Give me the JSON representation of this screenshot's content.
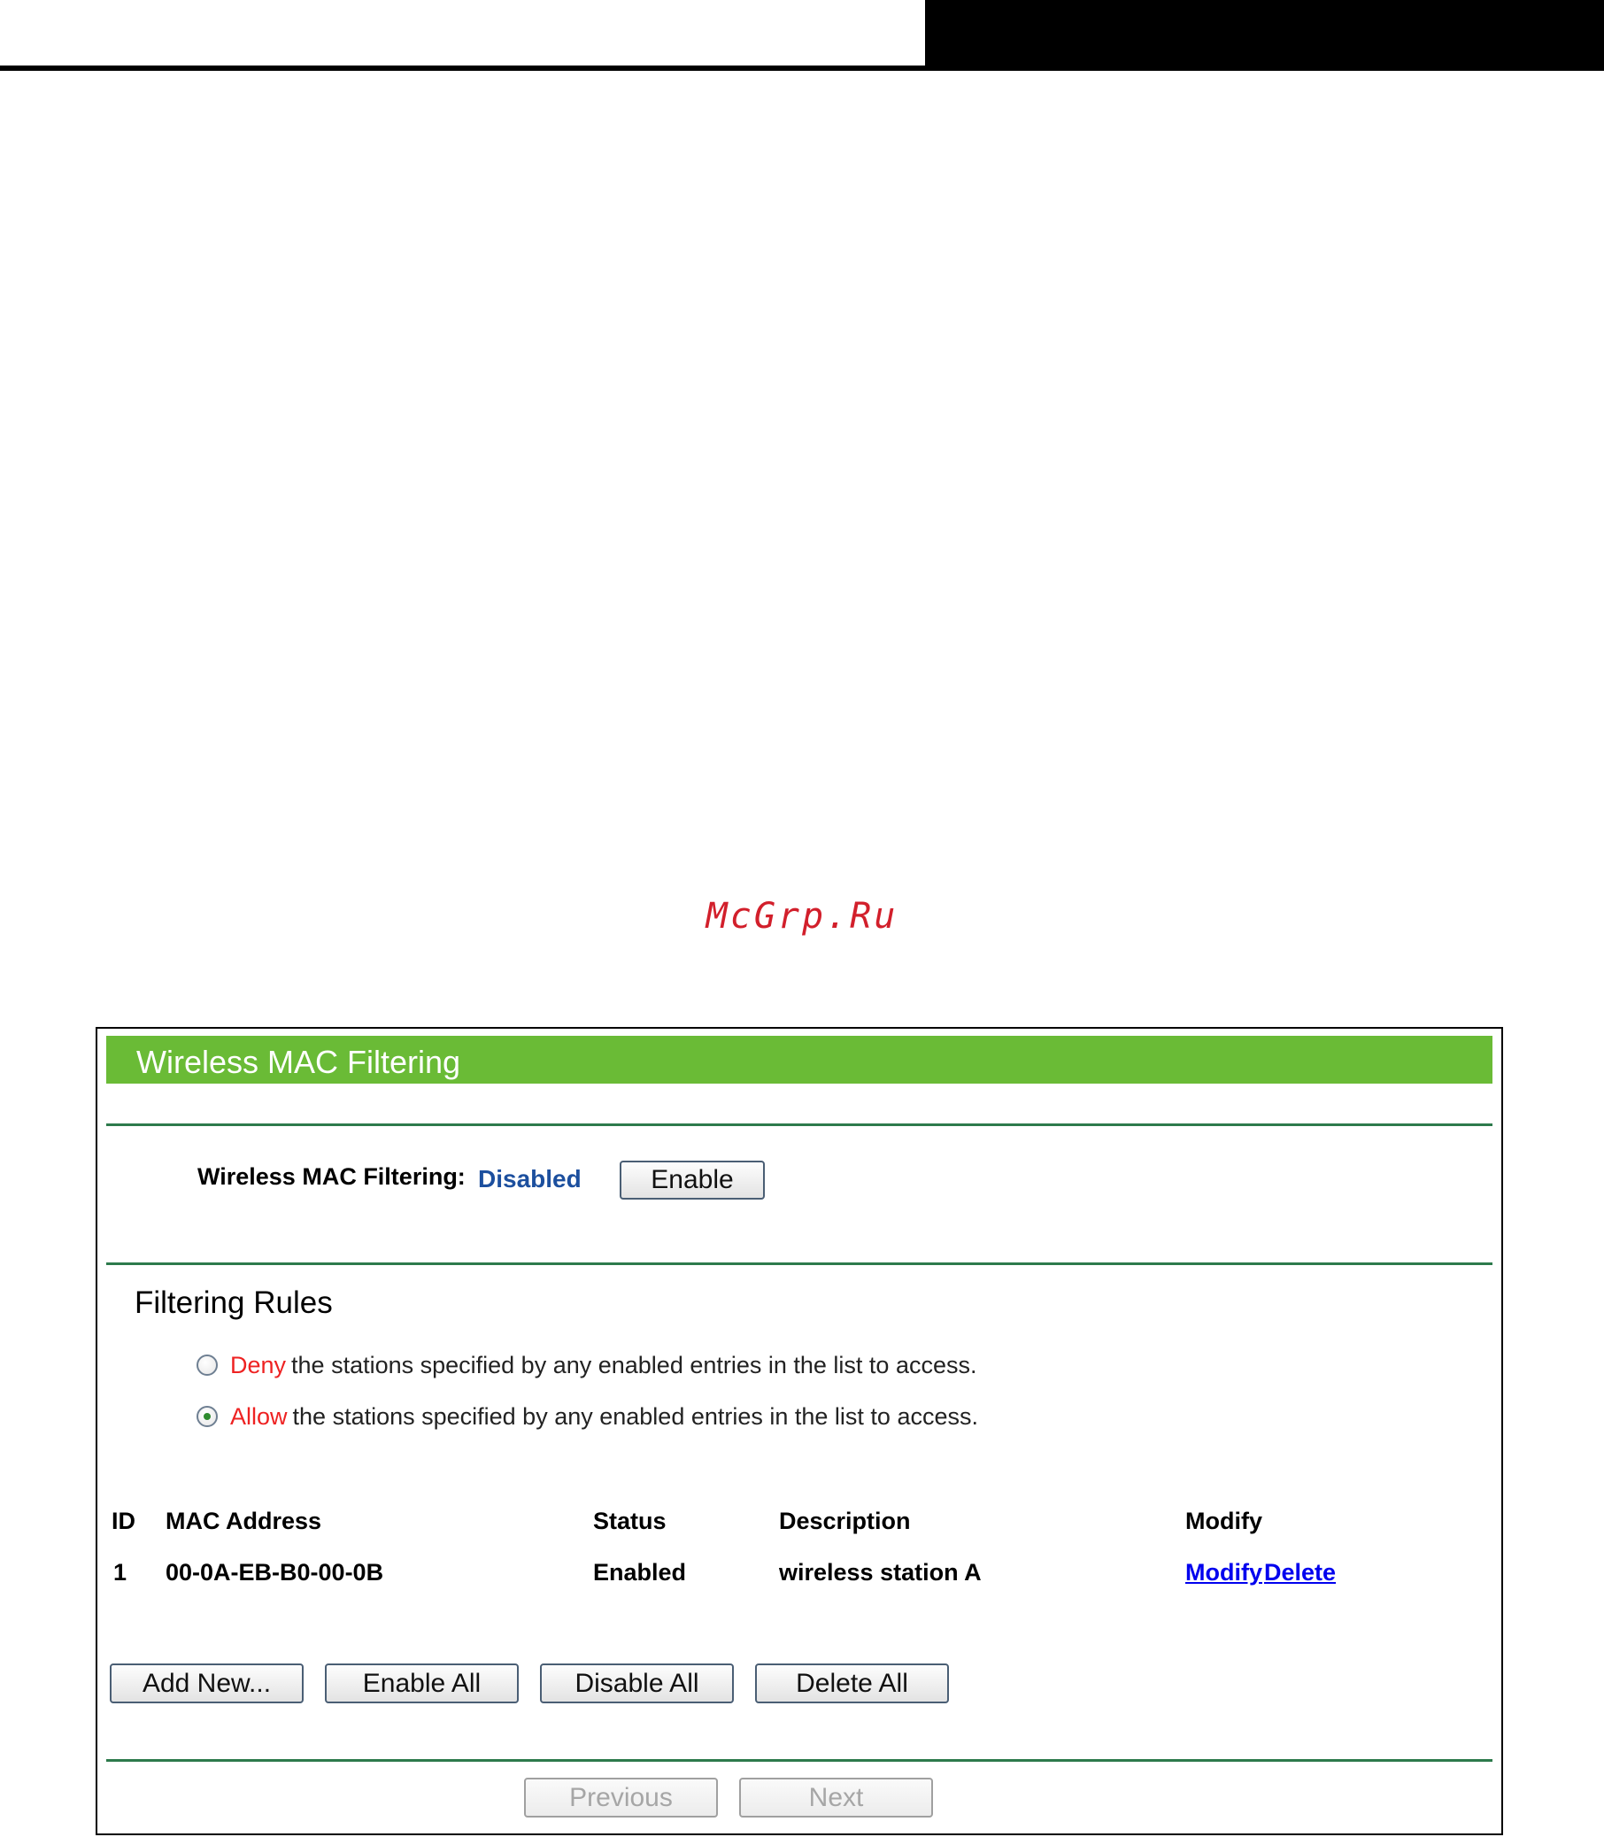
{
  "watermark": "McGrp.Ru",
  "panel": {
    "title": "Wireless MAC Filtering",
    "status_label": "Wireless MAC Filtering:",
    "status_value": "Disabled",
    "enable_button": "Enable",
    "section_heading": "Filtering Rules",
    "rules": [
      {
        "keyword": "Deny",
        "text": "the stations specified by any enabled entries in the list to access.",
        "checked": false
      },
      {
        "keyword": "Allow",
        "text": "the stations specified by any enabled entries in the list to access.",
        "checked": true
      }
    ],
    "table": {
      "headers": [
        "ID",
        "MAC Address",
        "Status",
        "Description",
        "Modify"
      ],
      "rows": [
        {
          "id": "1",
          "mac": "00-0A-EB-B0-00-0B",
          "status": "Enabled",
          "description": "wireless station A",
          "modify_link": "Modify",
          "delete_link": "Delete"
        }
      ]
    },
    "buttons": {
      "add_new": "Add New...",
      "enable_all": "Enable All",
      "disable_all": "Disable All",
      "delete_all": "Delete All",
      "previous": "Previous",
      "next": "Next"
    }
  },
  "colors": {
    "title_bar": "#6abb36",
    "separator": "#2d7a4c",
    "status_value": "#1c4f9e",
    "rule_keyword": "#ee2222",
    "link": "#0000ee",
    "watermark": "#d21f2b"
  }
}
